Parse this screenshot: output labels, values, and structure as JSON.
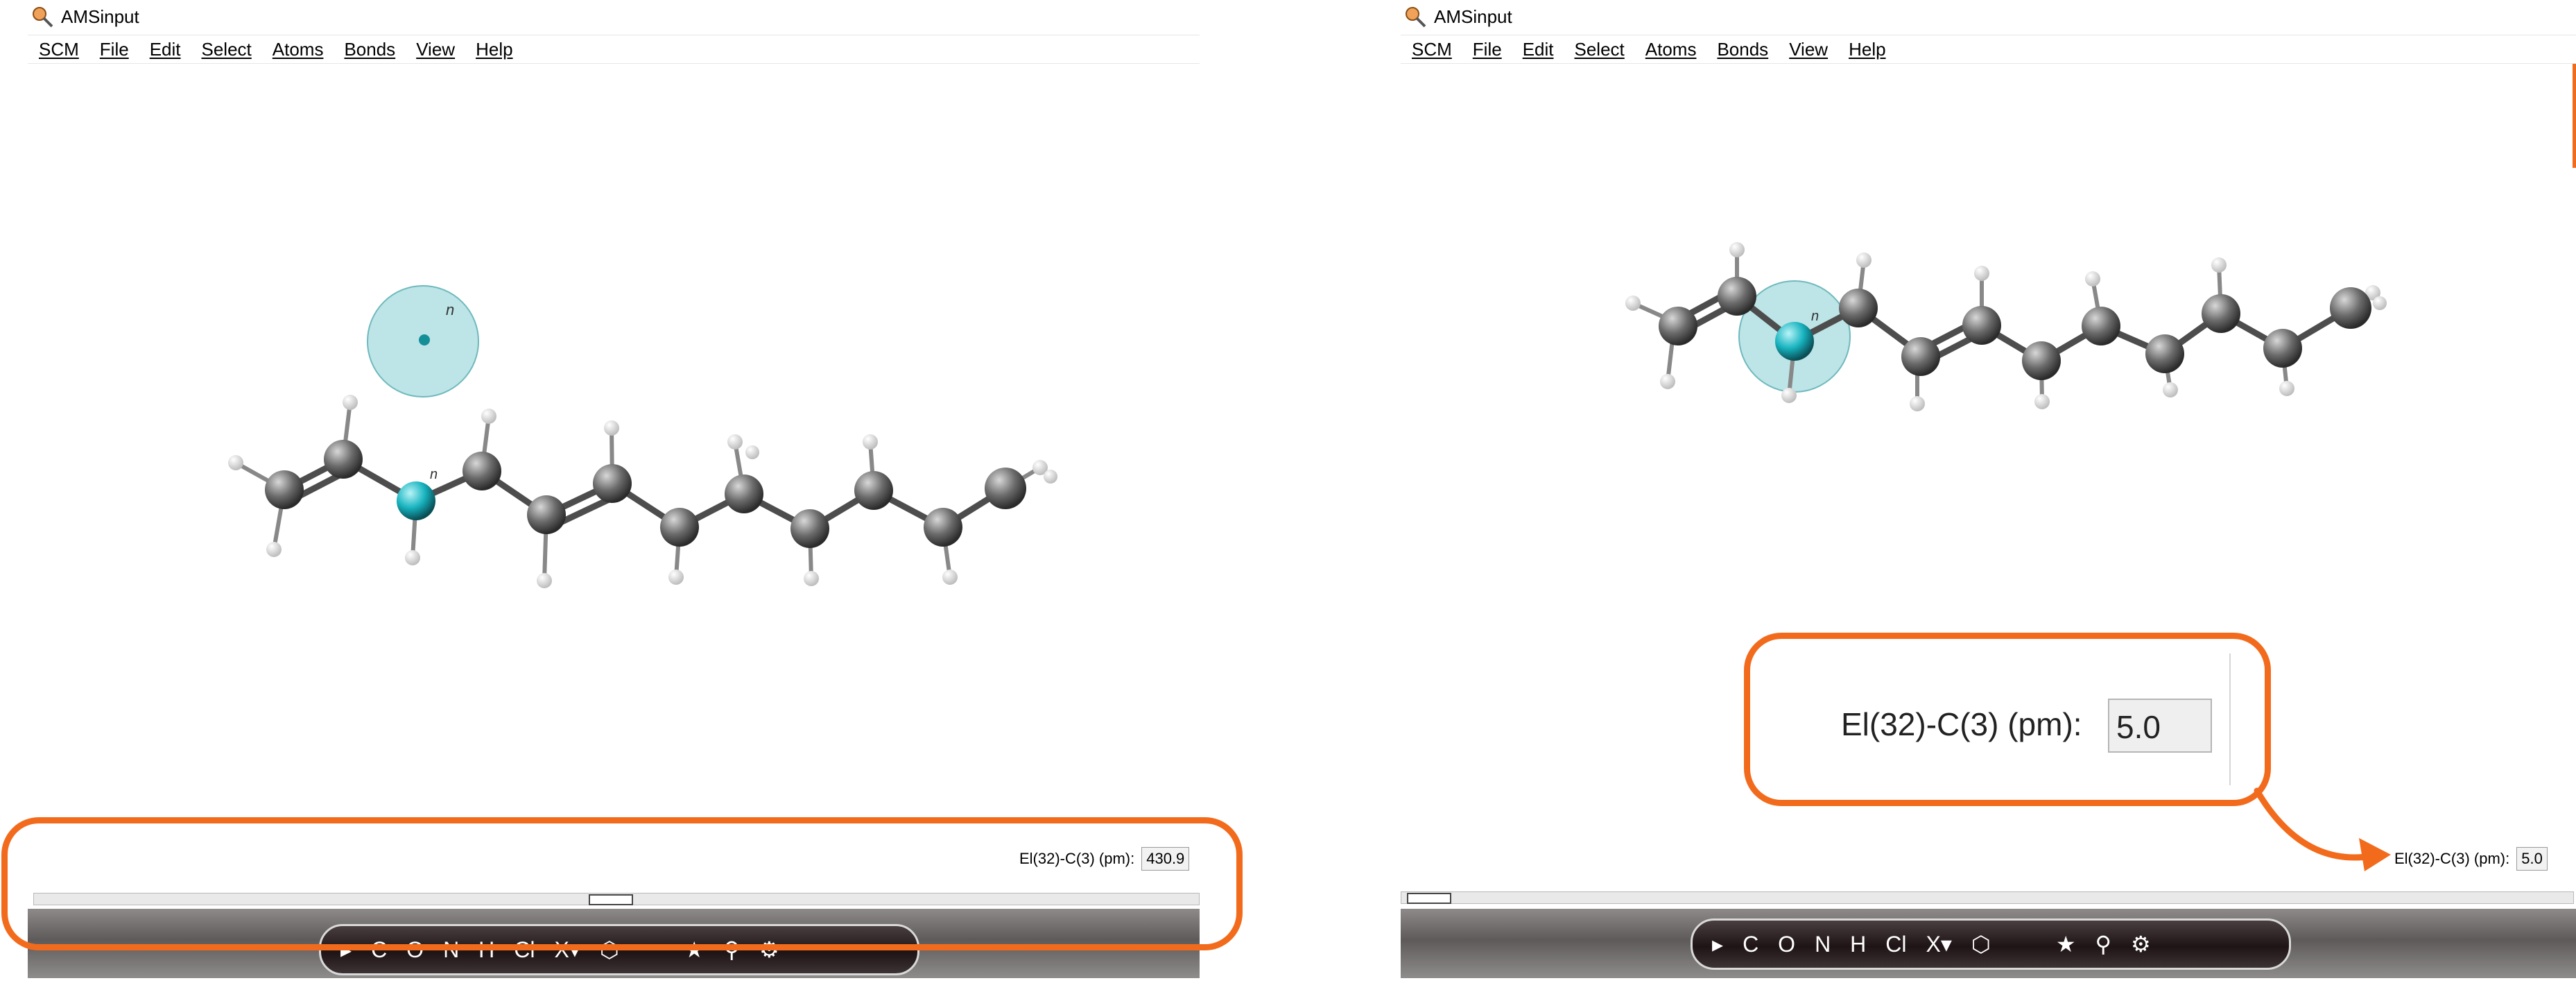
{
  "left": {
    "title": "AMSinput",
    "menu": [
      "SCM",
      "File",
      "Edit",
      "Select",
      "Atoms",
      "Bonds",
      "View",
      "Help"
    ],
    "measure_label": "El(32)-C(3) (pm):",
    "measure_value": "430.9",
    "tools": [
      "▸",
      "C",
      "O",
      "N",
      "H",
      "Cl",
      "X▾",
      "⬡",
      "★",
      "⚲",
      "⚙"
    ],
    "atom_label": "n"
  },
  "right": {
    "title": "AMSinput",
    "menu": [
      "SCM",
      "File",
      "Edit",
      "Select",
      "Atoms",
      "Bonds",
      "View",
      "Help"
    ],
    "measure_label": "El(32)-C(3) (pm):",
    "measure_value": "5.0",
    "tools": [
      "▸",
      "C",
      "O",
      "N",
      "H",
      "Cl",
      "X▾",
      "⬡",
      "★",
      "⚲",
      "⚙"
    ],
    "atom_label": "n"
  },
  "zoom": {
    "label": "El(32)-C(3) (pm):",
    "value": "5.0"
  },
  "colors": {
    "highlight": "#f26b1d",
    "selected_atom": "#17b3bf",
    "carbon": "#666666",
    "hydrogen": "#f4f4f4"
  }
}
